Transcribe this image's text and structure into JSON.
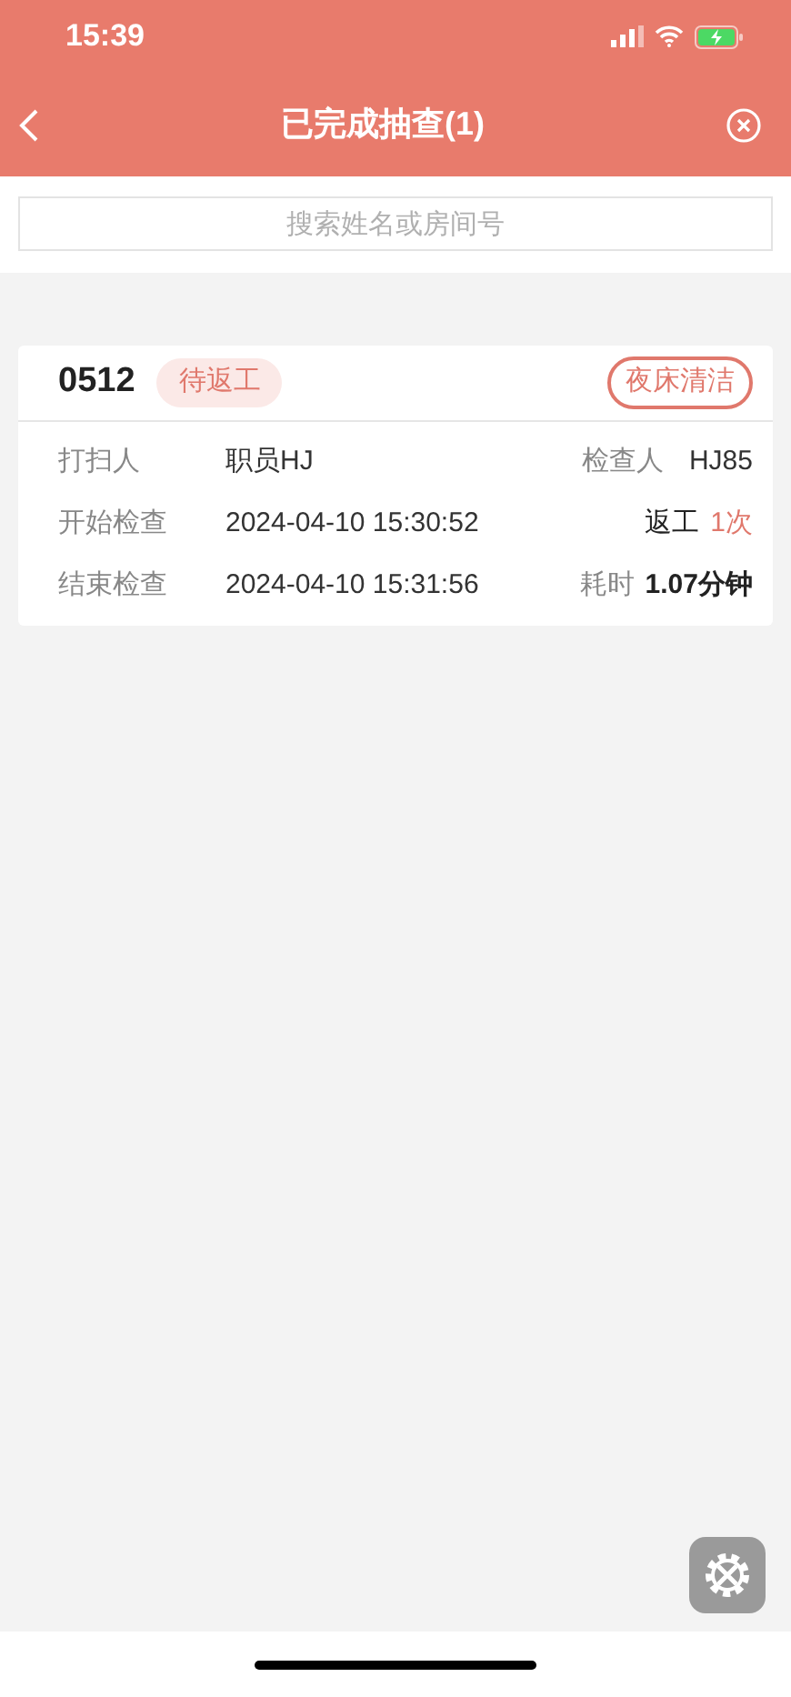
{
  "status_bar": {
    "time": "15:39"
  },
  "nav": {
    "title": "已完成抽查(1)"
  },
  "search": {
    "placeholder": "搜索姓名或房间号"
  },
  "records": [
    {
      "room": "0512",
      "status": "待返工",
      "task_type": "夜床清洁",
      "cleaner_label": "打扫人",
      "cleaner": "职员HJ",
      "inspector_label": "检查人",
      "inspector": "HJ85",
      "start_label": "开始检查",
      "start": "2024-04-10 15:30:52",
      "rework_label": "返工",
      "rework_count": "1次",
      "end_label": "结束检查",
      "end": "2024-04-10 15:31:56",
      "duration_label": "耗时",
      "duration": "1.07分钟"
    }
  ]
}
